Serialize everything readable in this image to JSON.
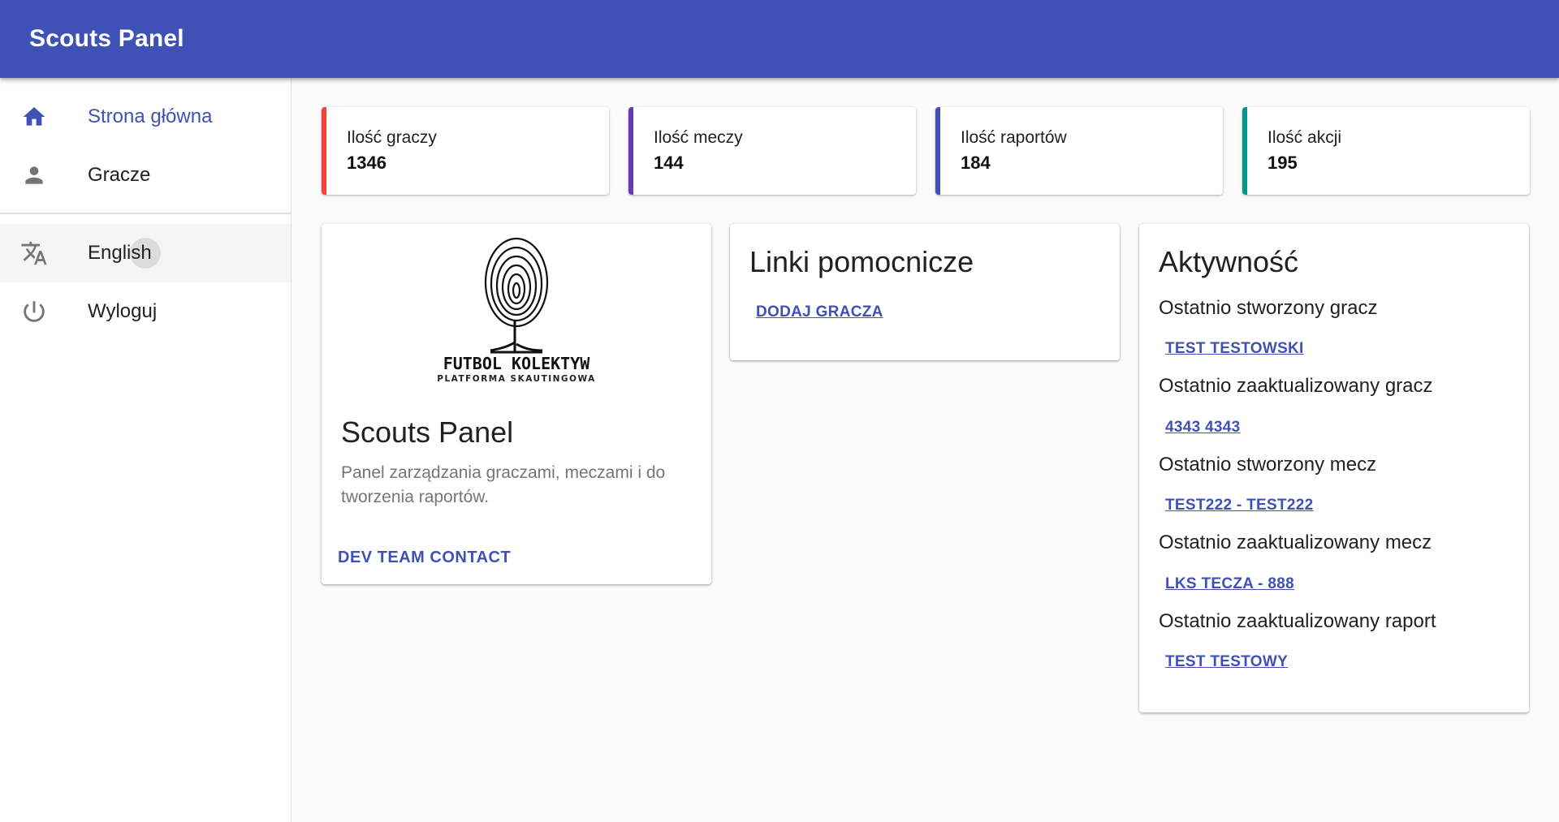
{
  "app": {
    "title": "Scouts Panel"
  },
  "sidebar": {
    "items": [
      {
        "label": "Strona główna",
        "icon": "home-icon"
      },
      {
        "label": "Gracze",
        "icon": "person-icon"
      },
      {
        "label": "English",
        "icon": "translate-icon"
      },
      {
        "label": "Wyloguj",
        "icon": "power-icon"
      }
    ]
  },
  "stats": [
    {
      "label": "Ilość graczy",
      "value": "1346",
      "color": "#f44336"
    },
    {
      "label": "Ilość meczy",
      "value": "144",
      "color": "#673ab7"
    },
    {
      "label": "Ilość raportów",
      "value": "184",
      "color": "#3f51b5"
    },
    {
      "label": "Ilość akcji",
      "value": "195",
      "color": "#009688"
    }
  ],
  "about": {
    "logo_title": "FUTBOL KOLEKTYW",
    "logo_subtitle": "PLATFORMA SKAUTINGOWA",
    "title": "Scouts Panel",
    "description": "Panel zarządzania graczami, meczami i do tworzenia raportów.",
    "button": "DEV TEAM CONTACT"
  },
  "links": {
    "title": "Linki pomocnicze",
    "add_player": "DODAJ GRACZA"
  },
  "activity": {
    "title": "Aktywność",
    "entries": [
      {
        "label": "Ostatnio stworzony gracz",
        "link": "TEST TESTOWSKI"
      },
      {
        "label": "Ostatnio zaaktualizowany gracz",
        "link": "4343 4343"
      },
      {
        "label": "Ostatnio stworzony mecz",
        "link": "TEST222 - TEST222"
      },
      {
        "label": "Ostatnio zaaktualizowany mecz",
        "link": "LKS TECZA - 888"
      },
      {
        "label": "Ostatnio zaaktualizowany raport",
        "link": "TEST TESTOWY"
      }
    ]
  },
  "theme": {
    "primary": "#3f51b5",
    "background": "#fafafa"
  }
}
